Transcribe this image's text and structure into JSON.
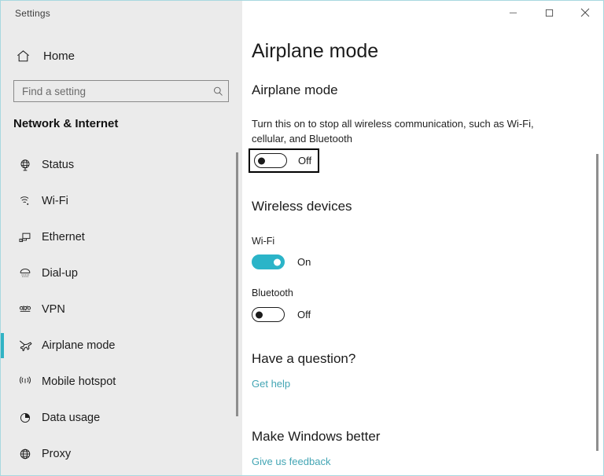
{
  "window": {
    "app_title": "Settings",
    "border_color": "#a8d8e0",
    "controls": [
      {
        "name": "minimize",
        "glyph": "─"
      },
      {
        "name": "maximize",
        "glyph": "□"
      },
      {
        "name": "close",
        "glyph": "✕"
      }
    ]
  },
  "sidebar": {
    "home_label": "Home",
    "home_icon": "home-icon",
    "search": {
      "placeholder": "Find a setting",
      "value": "",
      "icon": "search-icon"
    },
    "category": "Network & Internet",
    "accent_color": "#31b3c4",
    "items": [
      {
        "label": "Status",
        "icon": "globe-status-icon",
        "selected": false
      },
      {
        "label": "Wi-Fi",
        "icon": "wifi-icon",
        "selected": false
      },
      {
        "label": "Ethernet",
        "icon": "ethernet-icon",
        "selected": false
      },
      {
        "label": "Dial-up",
        "icon": "dialup-icon",
        "selected": false
      },
      {
        "label": "VPN",
        "icon": "vpn-icon",
        "selected": false
      },
      {
        "label": "Airplane mode",
        "icon": "airplane-icon",
        "selected": true
      },
      {
        "label": "Mobile hotspot",
        "icon": "hotspot-icon",
        "selected": false
      },
      {
        "label": "Data usage",
        "icon": "data-usage-icon",
        "selected": false
      },
      {
        "label": "Proxy",
        "icon": "proxy-globe-icon",
        "selected": false
      }
    ]
  },
  "main": {
    "page_title": "Airplane mode",
    "airplane_section": {
      "heading": "Airplane mode",
      "description": "Turn this on to stop all wireless communication, such as Wi-Fi, cellular, and Bluetooth",
      "toggle": {
        "state": "Off",
        "on": false,
        "highlighted": true
      }
    },
    "wireless_section": {
      "heading": "Wireless devices",
      "devices": [
        {
          "label": "Wi-Fi",
          "state": "On",
          "on": true
        },
        {
          "label": "Bluetooth",
          "state": "Off",
          "on": false
        }
      ]
    },
    "question_section": {
      "heading": "Have a question?",
      "link": "Get help"
    },
    "feedback_section": {
      "heading": "Make Windows better",
      "link": "Give us feedback"
    },
    "link_color": "#43a5b4",
    "toggle_on_color": "#2bb4c8"
  }
}
